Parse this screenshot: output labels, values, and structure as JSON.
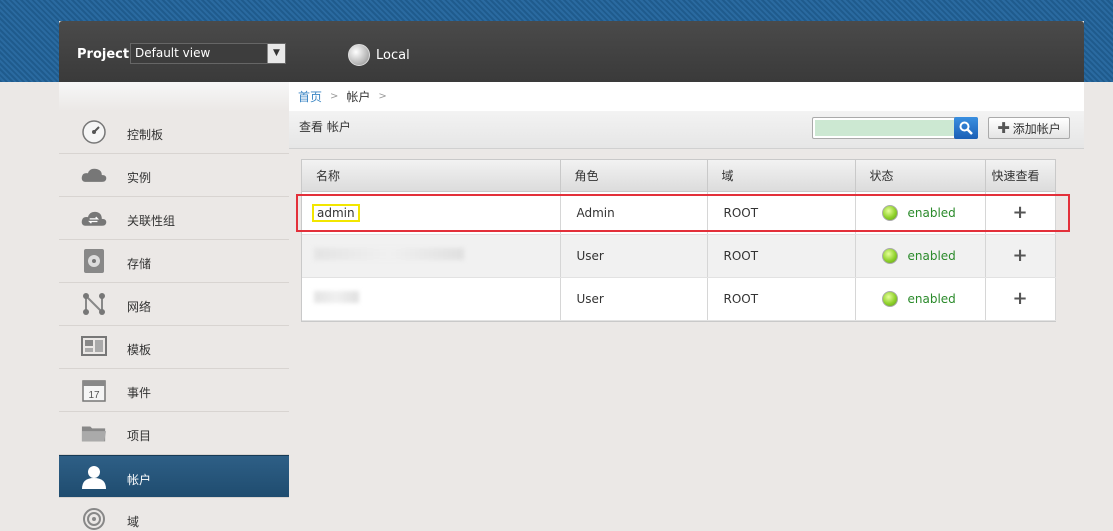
{
  "header": {
    "project_label": "Project:",
    "project_value": "Default view",
    "zone": "Local"
  },
  "sidebar": {
    "items": [
      {
        "label": "控制板",
        "icon": "dashboard-icon",
        "active": false
      },
      {
        "label": "实例",
        "icon": "cloud-icon",
        "active": false
      },
      {
        "label": "关联性组",
        "icon": "affinity-cloud-icon",
        "active": false
      },
      {
        "label": "存储",
        "icon": "storage-icon",
        "active": false
      },
      {
        "label": "网络",
        "icon": "network-icon",
        "active": false
      },
      {
        "label": "模板",
        "icon": "template-icon",
        "active": false
      },
      {
        "label": "事件",
        "icon": "calendar-icon",
        "active": false
      },
      {
        "label": "项目",
        "icon": "folder-icon",
        "active": false
      },
      {
        "label": "帐户",
        "icon": "user-icon",
        "active": true
      },
      {
        "label": "域",
        "icon": "domain-icon",
        "active": false
      }
    ],
    "calendar_day": "17"
  },
  "breadcrumb": {
    "home": "首页",
    "sep": ">",
    "current": "帐户"
  },
  "toolbar": {
    "title": "查看 帐户",
    "search_placeholder": "",
    "add_label": "添加帐户"
  },
  "table": {
    "columns": [
      "名称",
      "角色",
      "域",
      "状态",
      "快速查看"
    ],
    "rows": [
      {
        "name": "admin",
        "role": "Admin",
        "domain": "ROOT",
        "status": "enabled",
        "quick": "+"
      },
      {
        "name": "",
        "role": "User",
        "domain": "ROOT",
        "status": "enabled",
        "quick": "+"
      },
      {
        "name": "",
        "role": "User",
        "domain": "ROOT",
        "status": "enabled",
        "quick": "+"
      }
    ]
  },
  "colors": {
    "active_nav": "#1f4c6f",
    "enabled_text": "#2a8a2a",
    "highlight_red": "#e3303a",
    "highlight_yellow": "#f2e600"
  }
}
